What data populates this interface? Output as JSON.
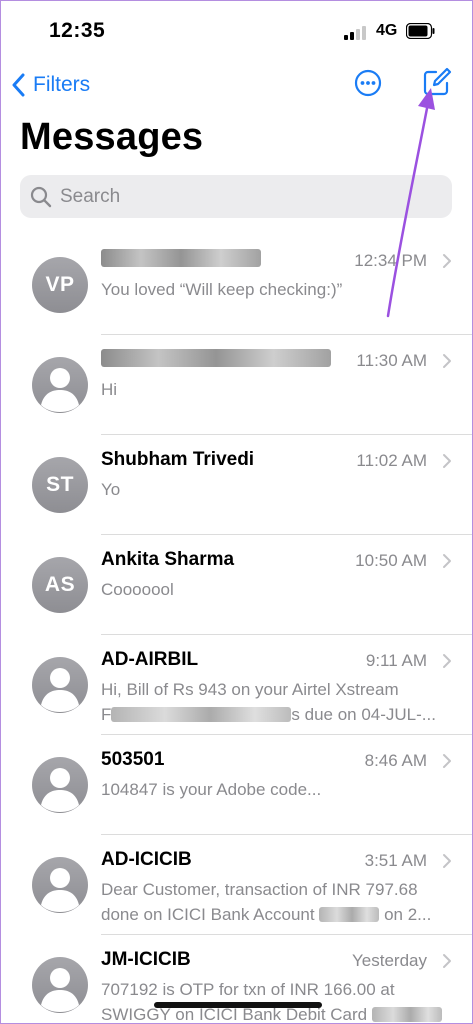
{
  "status_bar": {
    "time": "12:35",
    "network": "4G",
    "icons": [
      "cellular-signal-icon",
      "battery-icon"
    ]
  },
  "nav": {
    "back_label": "Filters",
    "more_icon": "ellipsis-circle-icon",
    "compose_icon": "compose-icon",
    "accent_color": "#1a7cf5"
  },
  "title": "Messages",
  "search": {
    "placeholder": "Search",
    "value": ""
  },
  "annotation_arrow_color": "#9b51e0",
  "conversations": [
    {
      "initials": "VP",
      "name": "",
      "name_redacted": true,
      "time": "12:34 PM",
      "preview_1": "You loved “Will keep checking:)”",
      "preview_2": ""
    },
    {
      "initials": "",
      "name": "",
      "name_redacted": true,
      "time": "11:30 AM",
      "preview_1": "Hi",
      "preview_2": ""
    },
    {
      "initials": "ST",
      "name": "Shubham Trivedi",
      "time": "11:02 AM",
      "preview_1": "Yo",
      "preview_2": ""
    },
    {
      "initials": "AS",
      "name": "Ankita Sharma",
      "time": "10:50 AM",
      "preview_1": "Cooooool",
      "preview_2": ""
    },
    {
      "initials": "",
      "name": "AD-AIRBIL",
      "time": "9:11 AM",
      "preview_1": "Hi, Bill of Rs 943 on your Airtel Xstream",
      "preview_2_prefix": "F",
      "preview_2_suffix": "s due on 04-JUL-..."
    },
    {
      "initials": "",
      "name": "503501",
      "time": "8:46 AM",
      "preview_1": "104847 is your Adobe code...",
      "preview_2": ""
    },
    {
      "initials": "",
      "name": "AD-ICICIB",
      "time": "3:51 AM",
      "preview_1": "Dear Customer, transaction of INR 797.68",
      "preview_2_prefix": "done on ICICI Bank Account",
      "preview_2_suffix": "on 2..."
    },
    {
      "initials": "",
      "name": "JM-ICICIB",
      "time": "Yesterday",
      "preview_1": "707192 is OTP for txn of INR 166.00 at",
      "preview_2_prefix": "SWIGGY on ICICI Bank Debit Card",
      "preview_2_suffix": ""
    }
  ]
}
